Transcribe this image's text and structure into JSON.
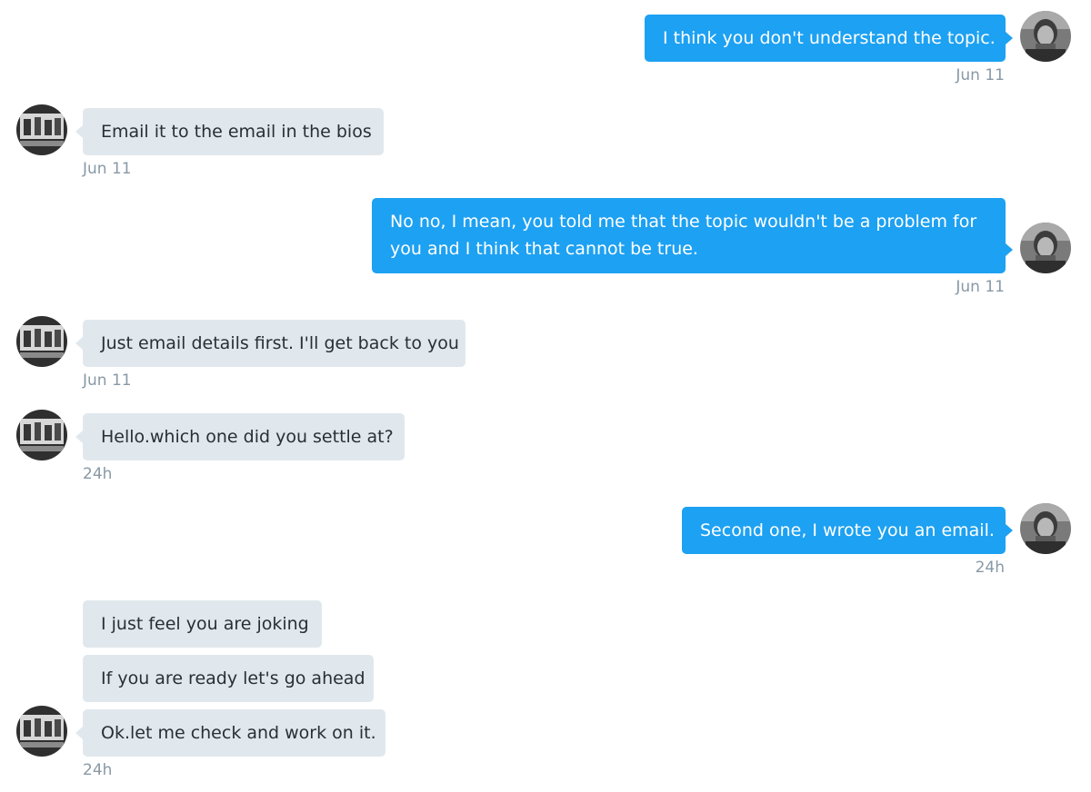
{
  "conversation": {
    "messages": [
      {
        "text": "I think you don't understand the topic.",
        "time": "Jun 11"
      },
      {
        "text": "Email it to the email in the bios",
        "time": "Jun 11"
      },
      {
        "text": "No no, I mean, you told me that the topic wouldn't be a problem for you and I think that cannot be true.",
        "time": "Jun 11"
      },
      {
        "text": "Just email details first. I'll get back to you",
        "time": "Jun 11"
      },
      {
        "text": "Hello.which one did you settle at?",
        "time": "24h"
      },
      {
        "text": "Second one, I wrote you an email.",
        "time": "24h"
      },
      {
        "text": "I just feel you are joking"
      },
      {
        "text": "If you are ready let's go ahead"
      },
      {
        "text": "Ok.let me check and work on it.",
        "time": "24h"
      }
    ]
  },
  "colors": {
    "outgoing_bubble": "#1da1f2",
    "incoming_bubble": "#e1e8ed",
    "timestamp": "#8899a6"
  }
}
